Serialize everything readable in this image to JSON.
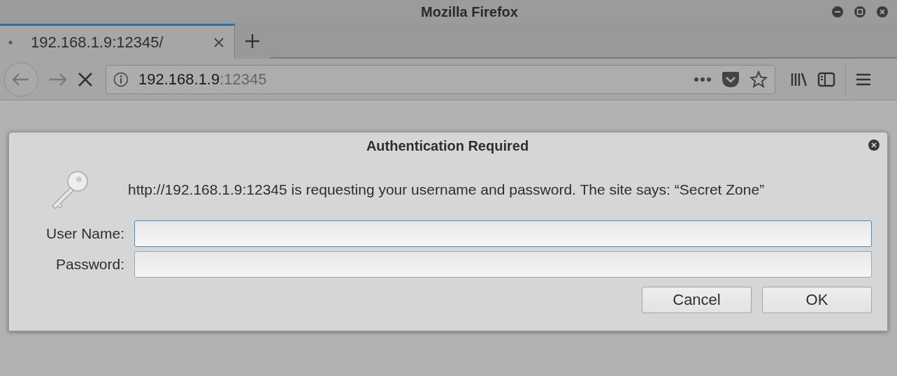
{
  "window": {
    "title": "Mozilla Firefox"
  },
  "tabs": [
    {
      "label": "192.168.1.9:12345/",
      "selected": true,
      "loading": true
    }
  ],
  "address": {
    "host": "192.168.1.9",
    "port": ":12345"
  },
  "dialog": {
    "title": "Authentication Required",
    "message": "http://192.168.1.9:12345 is requesting your username and password. The site says: “Secret Zone”",
    "fields": [
      {
        "label": "User Name:",
        "focused": true
      },
      {
        "label": "Password:",
        "focused": false
      }
    ],
    "buttons": [
      "Cancel",
      "OK"
    ]
  }
}
